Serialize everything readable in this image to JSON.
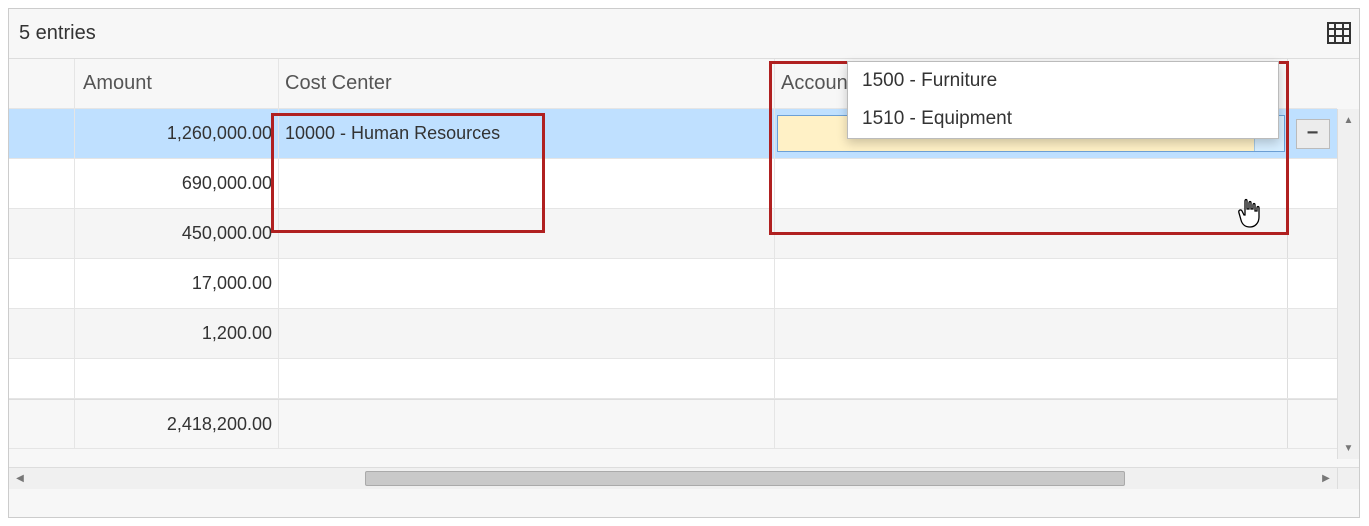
{
  "topbar": {
    "entries_label": "5 entries"
  },
  "columns": {
    "amount": "Amount",
    "cost_center": "Cost Center",
    "account": "Account"
  },
  "rows": [
    {
      "amount": "1,260,000.00",
      "cost_center": "10000 - Human Resources",
      "selected": true
    },
    {
      "amount": "690,000.00",
      "cost_center": ""
    },
    {
      "amount": "450,000.00",
      "cost_center": ""
    },
    {
      "amount": "17,000.00",
      "cost_center": ""
    },
    {
      "amount": "1,200.00",
      "cost_center": ""
    }
  ],
  "footer": {
    "total_amount": "2,418,200.00"
  },
  "dropdown": {
    "options": [
      "1500 - Furniture",
      "1510 - Equipment"
    ]
  },
  "remove_button_label": "−"
}
